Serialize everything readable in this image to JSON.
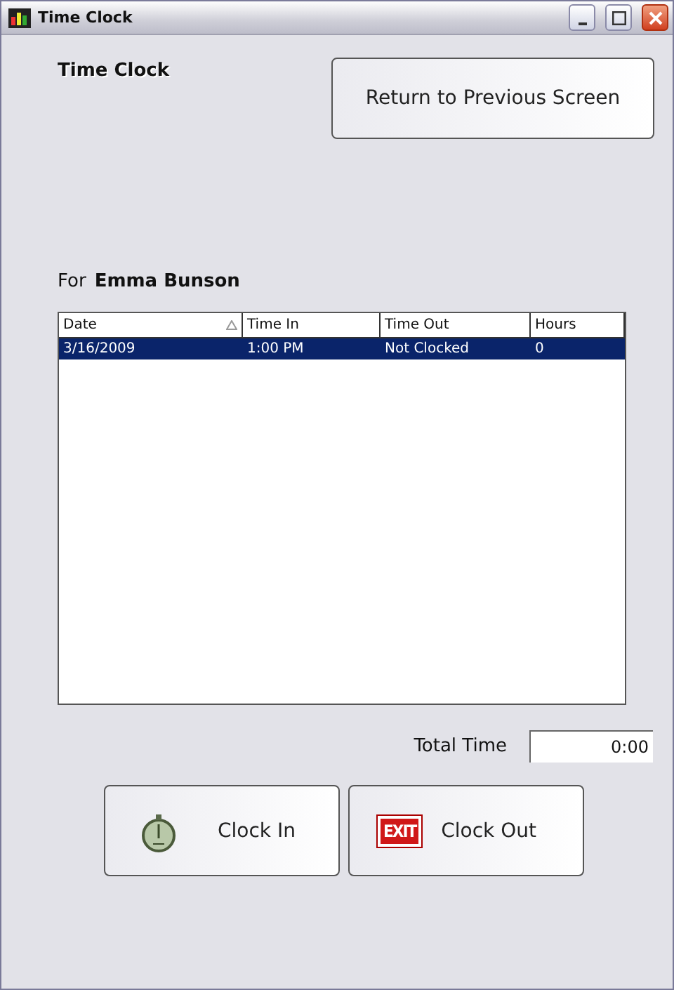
{
  "window": {
    "title": "Time Clock"
  },
  "heading": "Time Clock",
  "return_button": "Return to Previous Screen",
  "for_label": "For",
  "employee": "Emma Bunson",
  "table": {
    "columns": [
      {
        "label": "Date",
        "sorted": true
      },
      {
        "label": "Time In",
        "sorted": false
      },
      {
        "label": "Time Out",
        "sorted": false
      },
      {
        "label": "Hours",
        "sorted": false
      }
    ],
    "rows": [
      {
        "cells": [
          "3/16/2009",
          "1:00 PM",
          "Not Clocked",
          "0"
        ],
        "selected": true
      }
    ]
  },
  "total": {
    "label": "Total Time",
    "value": "0:00"
  },
  "actions": [
    {
      "kind": "clock-in",
      "label": "Clock In"
    },
    {
      "kind": "clock-out",
      "label": "Clock Out",
      "icon_text": "EXIT"
    }
  ]
}
